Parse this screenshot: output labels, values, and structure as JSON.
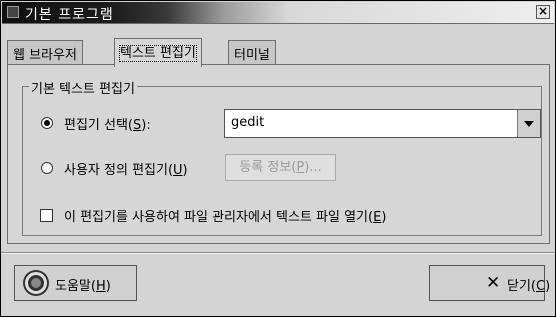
{
  "window": {
    "title": "기본 프로그램",
    "close_glyph": "×"
  },
  "tabs": [
    {
      "label": "웹 브라우저"
    },
    {
      "label": "텍스트 편집기"
    },
    {
      "label": "터미널"
    }
  ],
  "group": {
    "title": "기본 텍스트 편집기",
    "select_editor": {
      "label": "편집기 선택(",
      "mnemonic": "S",
      "tail": "):",
      "checked": true
    },
    "editor_combo": {
      "value": "gedit"
    },
    "custom_editor": {
      "label": "사용자 정의 편집기(",
      "mnemonic": "U",
      "tail": ")",
      "checked": false
    },
    "properties_button": {
      "label": "등록 정보(",
      "mnemonic": "P",
      "tail": ")...",
      "enabled": false
    },
    "open_in_terminal": {
      "label": "이 편집기를 사용하여 파일 관리자에서 텍스트 파일 열기(",
      "mnemonic": "E",
      "tail": ")",
      "checked": false
    }
  },
  "buttons": {
    "help": {
      "label": "도움말(",
      "mnemonic": "H",
      "tail": ")"
    },
    "close": {
      "label": "닫기(",
      "mnemonic": "C",
      "tail": ")"
    }
  },
  "icons": {
    "help": "help-lifebuoy-icon",
    "close": "x-icon"
  }
}
